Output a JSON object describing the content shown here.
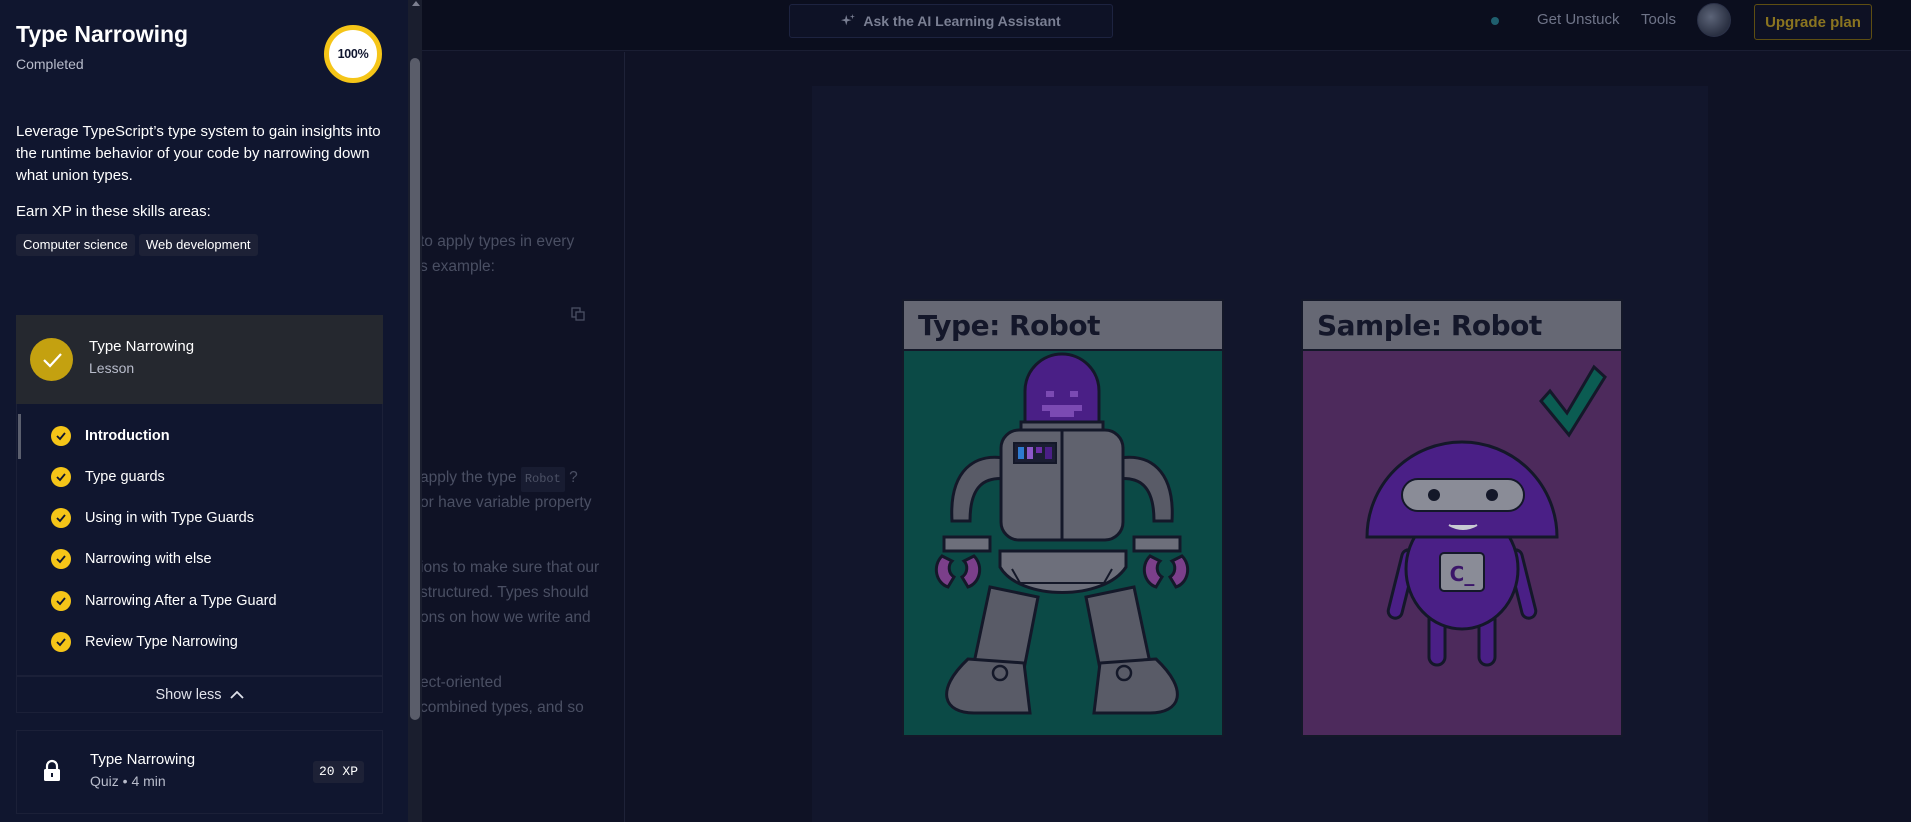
{
  "topbar": {
    "assistant_label": "Ask the AI Learning Assistant",
    "get_unstuck": "Get Unstuck",
    "tools": "Tools",
    "upgrade": "Upgrade plan"
  },
  "background_text": {
    "line1": "to apply types in every",
    "line2": "s example:",
    "line3_text": "apply the type ",
    "line3_code": "Robot",
    "line3_end": " ?",
    "line4": " or have variable property",
    "line5": "ions to make sure that our",
    "line6": " structured. Types should",
    "line7": "ons on how we write and",
    "line8": "ect-oriented",
    "line9": " combined types, and so"
  },
  "illustration": {
    "left_card_title": "Type: Robot",
    "right_card_title": "Sample:  Robot",
    "badge_text": "C_"
  },
  "panel": {
    "title": "Type Narrowing",
    "status": "Completed",
    "progress": "100%",
    "description": "Leverage TypeScript’s type system to gain insights into the runtime behavior of your code by narrowing down what union types.",
    "earn_label": "Earn XP in these skills areas:",
    "skills": [
      "Computer science",
      "Web development"
    ],
    "lesson": {
      "name": "Type Narrowing",
      "type": "Lesson"
    },
    "subitems": [
      "Introduction",
      "Type guards",
      "Using in with Type Guards",
      "Narrowing with else",
      "Narrowing After a Type Guard",
      "Review Type Narrowing"
    ],
    "show_less": "Show less",
    "quiz": {
      "name": "Type Narrowing",
      "meta": "Quiz • 4 min",
      "xp": "20 XP"
    }
  },
  "colors": {
    "accent_yellow": "#f5c518",
    "lesson_check": "#c4a110",
    "panel_bg": "#10162f",
    "teal_card": "#0b4a46",
    "purple_card": "#4d2a5c"
  },
  "icons": [
    "sparkle-icon",
    "copy-icon",
    "checkmark-icon",
    "chevron-up-icon",
    "lock-icon"
  ]
}
